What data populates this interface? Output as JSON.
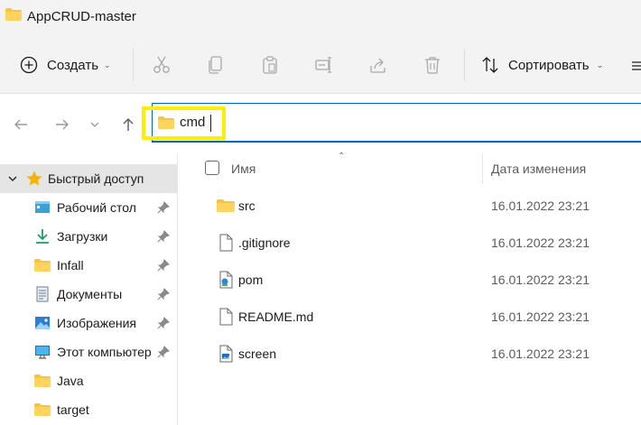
{
  "window": {
    "title": "AppCRUD-master"
  },
  "toolbar": {
    "create_label": "Создать",
    "sort_label": "Сортировать",
    "tools": [
      "cut-icon",
      "copy-icon",
      "paste-icon",
      "rename-icon",
      "share-icon",
      "delete-icon"
    ]
  },
  "address": {
    "value": "cmd"
  },
  "sidebar": {
    "quick_access": "Быстрый доступ",
    "items": [
      {
        "label": "Рабочий стол",
        "icon": "desktop-icon",
        "pinned": true
      },
      {
        "label": "Загрузки",
        "icon": "downloads-icon",
        "pinned": true
      },
      {
        "label": "Infall",
        "icon": "folder-icon",
        "pinned": true
      },
      {
        "label": "Документы",
        "icon": "documents-icon",
        "pinned": true
      },
      {
        "label": "Изображения",
        "icon": "pictures-icon",
        "pinned": true
      },
      {
        "label": "Этот компьютер",
        "icon": "computer-icon",
        "pinned": true
      },
      {
        "label": "Java",
        "icon": "folder-icon",
        "pinned": false
      },
      {
        "label": "target",
        "icon": "folder-icon",
        "pinned": false
      }
    ]
  },
  "list": {
    "columns": {
      "name": "Имя",
      "date": "Дата изменения"
    },
    "rows": [
      {
        "name": "src",
        "date": "16.01.2022 23:21",
        "icon": "folder-icon"
      },
      {
        "name": ".gitignore",
        "date": "16.01.2022 23:21",
        "icon": "file-icon"
      },
      {
        "name": "pom",
        "date": "16.01.2022 23:21",
        "icon": "xml-file-icon"
      },
      {
        "name": "README.md",
        "date": "16.01.2022 23:21",
        "icon": "file-icon"
      },
      {
        "name": "screen",
        "date": "16.01.2022 23:21",
        "icon": "image-file-icon"
      }
    ]
  },
  "colors": {
    "accent": "#0067c0",
    "highlight": "#ffee00",
    "folder": "#f8c43f",
    "selected": "#e5e5e5"
  }
}
